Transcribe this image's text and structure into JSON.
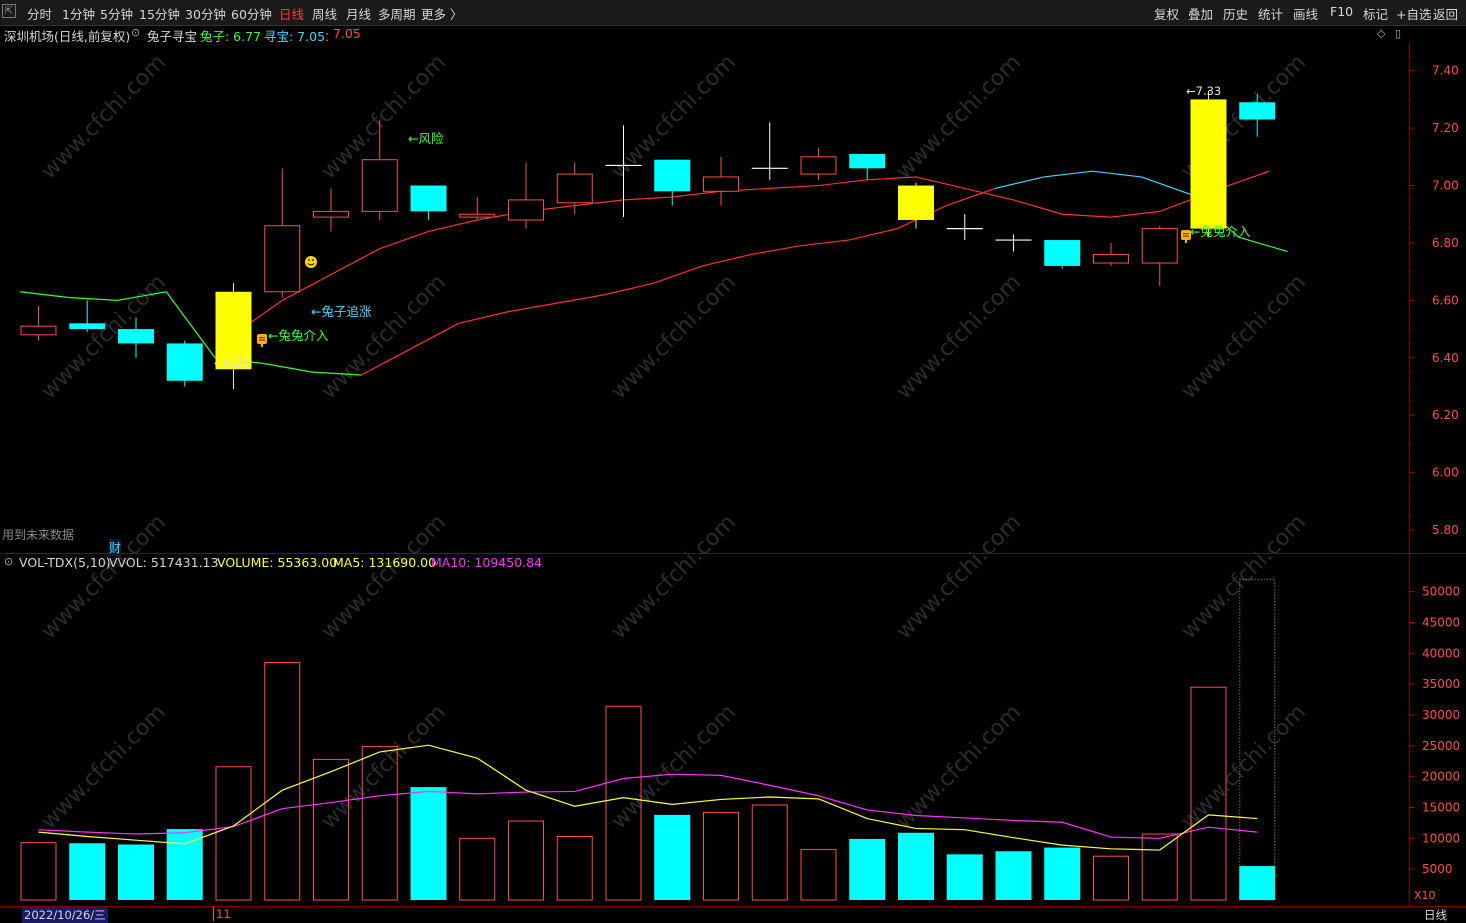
{
  "toolbar": {
    "left_items": [
      "分时",
      "1分钟",
      "5分钟",
      "15分钟",
      "30分钟",
      "60分钟",
      "日线",
      "周线",
      "月线",
      "多周期",
      "更多 〉"
    ],
    "active_item": "日线",
    "right_items": [
      "复权",
      "叠加",
      "历史",
      "统计",
      "画线",
      "F10",
      "标记",
      "+自选",
      "返回"
    ]
  },
  "header": {
    "title": "深圳机场(日线,前复权)",
    "indicator_name": "兔子寻宝",
    "rabbit_label": "兔子: 6.77",
    "xunbao_label": "寻宝: 7.05",
    "xunbao_sep": "：",
    "xunbao_value2": "7.05"
  },
  "price_axis": {
    "ticks": [
      "7.40",
      "7.20",
      "7.00",
      "6.80",
      "6.60",
      "6.40",
      "6.20",
      "6.00",
      "5.80"
    ],
    "values": [
      7.4,
      7.2,
      7.0,
      6.8,
      6.6,
      6.4,
      6.2,
      6.0,
      5.8
    ]
  },
  "volume_axis": {
    "ticks": [
      "50000",
      "45000",
      "40000",
      "35000",
      "30000",
      "25000",
      "20000",
      "15000",
      "10000",
      "5000"
    ],
    "values": [
      50000,
      45000,
      40000,
      35000,
      30000,
      25000,
      20000,
      15000,
      10000,
      5000
    ],
    "unit": "X10"
  },
  "annotations": {
    "risk": "←风险",
    "chase": "←兔子追涨",
    "enter1": "←兔兔介入",
    "enter2": "←兔兔介入",
    "low_price": "←6.29",
    "high_price": "←7.33",
    "future_data": "用到未来数据",
    "cai": "财"
  },
  "volume_header": {
    "name": "VOL-TDX(5,10)",
    "vvol": "VVOL: 517431.13",
    "volume": "VOLUME: 55363.00",
    "ma5": "MA5: 131690.00",
    "ma10": "MA10: 109450.84"
  },
  "statusbar": {
    "date": "2022/10/26/三",
    "month_mark": "11",
    "period": "日线"
  },
  "watermark": "www.cfchi.com",
  "colors": {
    "up": "#ff4a4a",
    "down": "#00ffff",
    "highlight": "#ffff00",
    "ma_red": "#ff2d2d",
    "line_green": "#33ff33",
    "line_cyan": "#3fd8ff",
    "ma5": "#ffff30",
    "ma10": "#ff30ff"
  },
  "chart_data": [
    {
      "type": "candlestick",
      "name": "深圳机场 日线",
      "ylim": [
        5.72,
        7.5
      ],
      "candles": [
        {
          "o": 6.48,
          "h": 6.58,
          "l": 6.46,
          "c": 6.51,
          "t": "up"
        },
        {
          "o": 6.52,
          "h": 6.6,
          "l": 6.49,
          "c": 6.5,
          "t": "down"
        },
        {
          "o": 6.5,
          "h": 6.54,
          "l": 6.4,
          "c": 6.45,
          "t": "down"
        },
        {
          "o": 6.45,
          "h": 6.46,
          "l": 6.3,
          "c": 6.32,
          "t": "down"
        },
        {
          "o": 6.36,
          "h": 6.66,
          "l": 6.29,
          "c": 6.63,
          "t": "hl"
        },
        {
          "o": 6.63,
          "h": 7.06,
          "l": 6.61,
          "c": 6.86,
          "t": "up"
        },
        {
          "o": 6.89,
          "h": 6.99,
          "l": 6.84,
          "c": 6.91,
          "t": "up"
        },
        {
          "o": 6.91,
          "h": 7.23,
          "l": 6.88,
          "c": 7.09,
          "t": "up"
        },
        {
          "o": 7.0,
          "h": 7.0,
          "l": 6.88,
          "c": 6.91,
          "t": "down"
        },
        {
          "o": 6.89,
          "h": 6.96,
          "l": 6.88,
          "c": 6.9,
          "t": "up"
        },
        {
          "o": 6.88,
          "h": 7.08,
          "l": 6.85,
          "c": 6.95,
          "t": "up"
        },
        {
          "o": 6.94,
          "h": 7.08,
          "l": 6.9,
          "c": 7.04,
          "t": "up"
        },
        {
          "o": 7.07,
          "h": 7.21,
          "l": 6.89,
          "c": 7.07,
          "t": "cross"
        },
        {
          "o": 7.09,
          "h": 7.09,
          "l": 6.93,
          "c": 6.98,
          "t": "down"
        },
        {
          "o": 6.98,
          "h": 7.1,
          "l": 6.93,
          "c": 7.03,
          "t": "up"
        },
        {
          "o": 7.06,
          "h": 7.22,
          "l": 7.02,
          "c": 7.06,
          "t": "cross"
        },
        {
          "o": 7.04,
          "h": 7.13,
          "l": 7.02,
          "c": 7.1,
          "t": "up"
        },
        {
          "o": 7.11,
          "h": 7.11,
          "l": 7.02,
          "c": 7.06,
          "t": "down"
        },
        {
          "o": 7.0,
          "h": 7.01,
          "l": 6.85,
          "c": 6.88,
          "t": "hl"
        },
        {
          "o": 6.85,
          "h": 6.9,
          "l": 6.81,
          "c": 6.85,
          "t": "cross"
        },
        {
          "o": 6.81,
          "h": 6.83,
          "l": 6.77,
          "c": 6.81,
          "t": "cross"
        },
        {
          "o": 6.81,
          "h": 6.81,
          "l": 6.71,
          "c": 6.72,
          "t": "down"
        },
        {
          "o": 6.73,
          "h": 6.8,
          "l": 6.72,
          "c": 6.76,
          "t": "up"
        },
        {
          "o": 6.73,
          "h": 6.86,
          "l": 6.65,
          "c": 6.85,
          "t": "up"
        },
        {
          "o": 6.85,
          "h": 7.33,
          "l": 6.82,
          "c": 7.3,
          "t": "hl"
        },
        {
          "o": 7.29,
          "h": 7.32,
          "l": 7.17,
          "c": 7.23,
          "t": "down"
        }
      ],
      "ma_red": [
        null,
        null,
        null,
        null,
        6.48,
        6.6,
        6.69,
        6.78,
        6.84,
        6.88,
        6.91,
        6.93,
        6.95,
        6.96,
        6.98,
        6.99,
        7.0,
        7.02,
        7.03,
        6.99,
        6.95,
        6.9,
        6.89,
        6.91,
        6.99,
        7.05
      ],
      "line_main": [
        6.63,
        6.61,
        6.6,
        6.63,
        6.4,
        6.38,
        6.35,
        6.34,
        6.43,
        6.52,
        6.56,
        6.59,
        6.62,
        6.66,
        6.72,
        6.76,
        6.79,
        6.81,
        6.85,
        6.93,
        6.99,
        7.03,
        7.05,
        7.03,
        6.97,
        6.82,
        6.77
      ],
      "line_main_colors": [
        "g",
        "g",
        "g",
        "g",
        "g",
        "g",
        "g",
        "g",
        "r",
        "r",
        "r",
        "r",
        "r",
        "r",
        "r",
        "r",
        "r",
        "r",
        "r",
        "r",
        "r",
        "g",
        "g",
        "g",
        "g",
        "g",
        "g"
      ]
    },
    {
      "type": "bar",
      "name": "VOL-TDX(5,10)",
      "ylim": [
        0,
        53500
      ],
      "values": [
        9300,
        9200,
        9000,
        11500,
        21600,
        38500,
        22800,
        24900,
        18300,
        10000,
        12800,
        10300,
        31400,
        13800,
        14200,
        15400,
        8200,
        9900,
        10900,
        7400,
        7900,
        8500,
        7100,
        10700,
        34500,
        5500
      ],
      "colors": [
        "up",
        "down",
        "down",
        "down",
        "up",
        "up",
        "up",
        "up",
        "down",
        "up",
        "up",
        "up",
        "up",
        "down",
        "up",
        "up",
        "up",
        "down",
        "down",
        "down",
        "down",
        "down",
        "up",
        "up",
        "up",
        "down"
      ],
      "ma5": [
        11000,
        10300,
        9700,
        9100,
        12000,
        17800,
        20800,
        24000,
        25100,
        23000,
        17800,
        15200,
        16600,
        15500,
        16300,
        16700,
        16400,
        13200,
        11600,
        11400,
        10100,
        8900,
        8300,
        8100,
        13800,
        13200
      ],
      "ma10": [
        11400,
        11000,
        10700,
        10900,
        11900,
        14800,
        15800,
        16900,
        17600,
        17200,
        17500,
        17600,
        19700,
        20400,
        20200,
        18600,
        16900,
        14600,
        13700,
        13300,
        12900,
        12600,
        10200,
        10000,
        11800,
        11000
      ]
    }
  ]
}
